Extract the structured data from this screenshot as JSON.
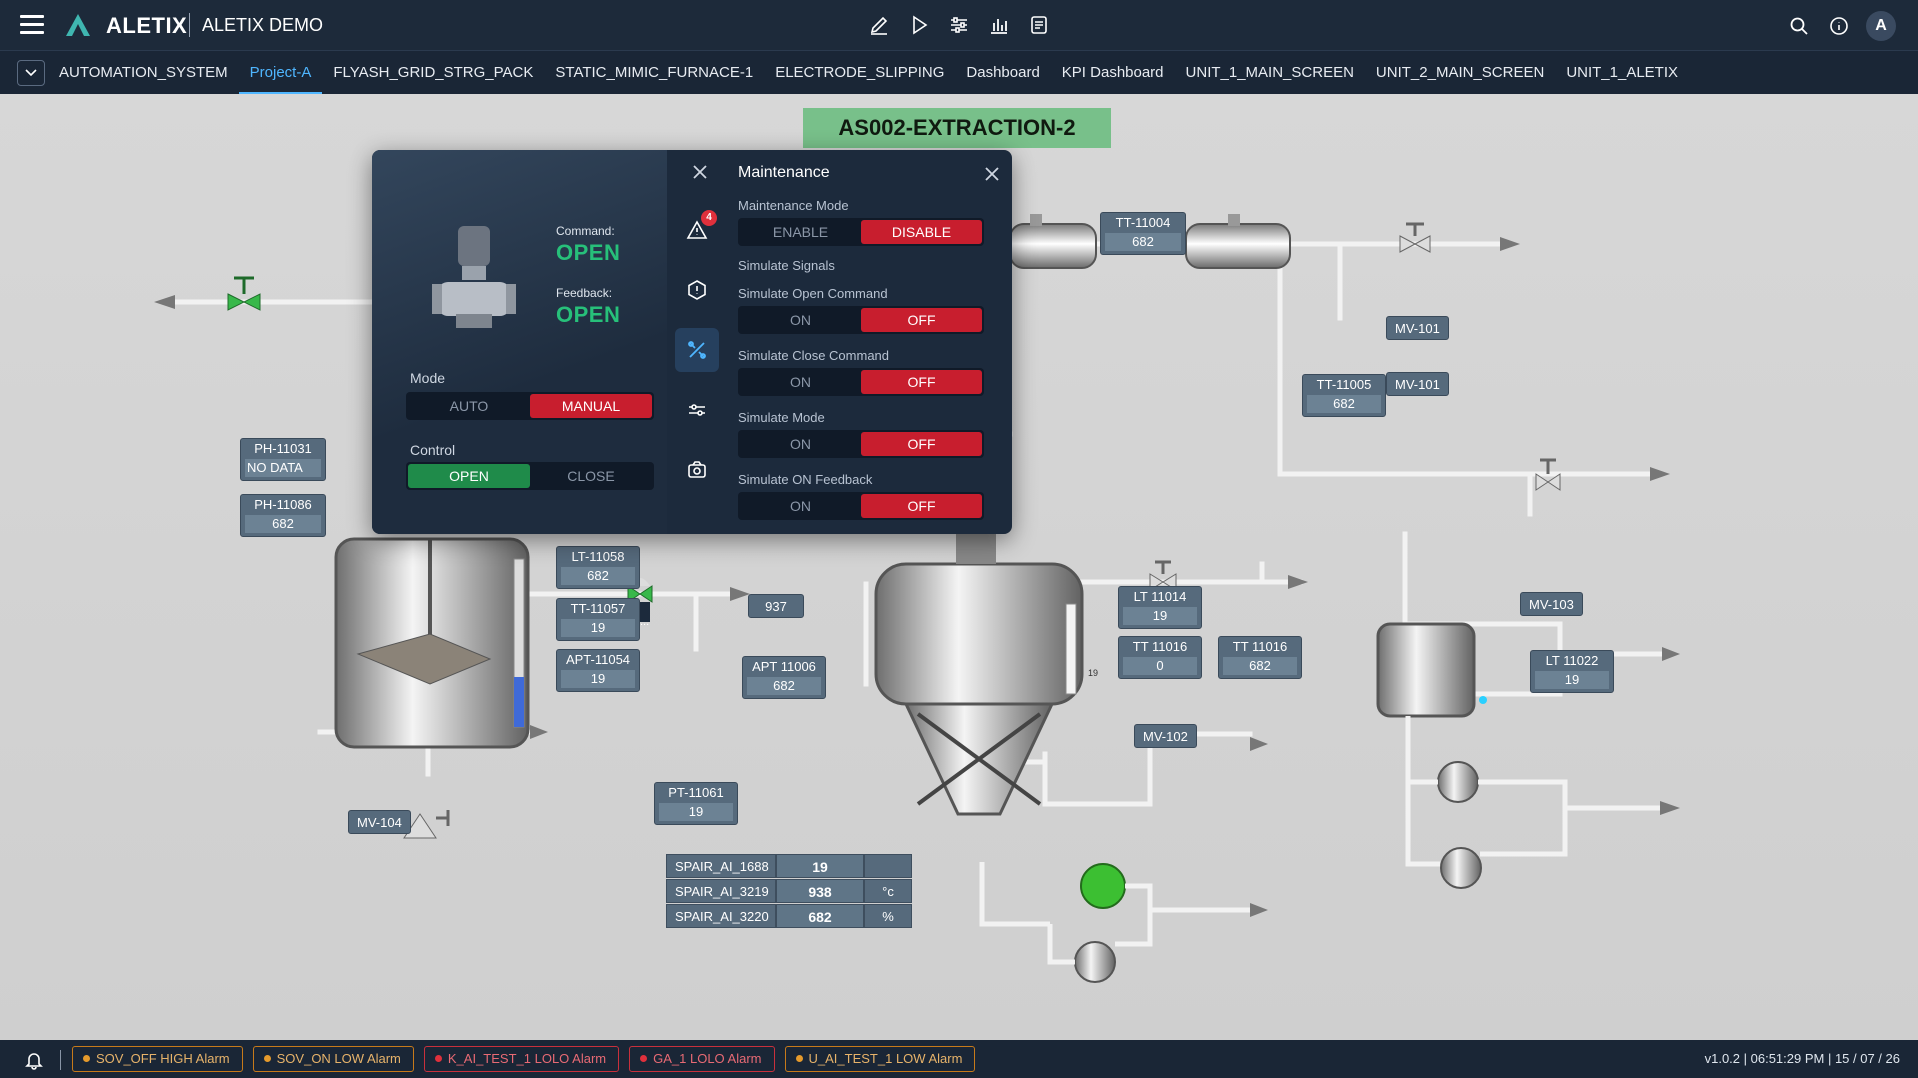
{
  "app": {
    "brand": "ALETIX",
    "project": "ALETIX DEMO",
    "user_initial": "A"
  },
  "tabs": [
    {
      "label": "AUTOMATION_SYSTEM"
    },
    {
      "label": "Project-A"
    },
    {
      "label": "FLYASH_GRID_STRG_PACK"
    },
    {
      "label": "STATIC_MIMIC_FURNACE-1"
    },
    {
      "label": "ELECTRODE_SLIPPING"
    },
    {
      "label": "Dashboard"
    },
    {
      "label": "KPI Dashboard"
    },
    {
      "label": "UNIT_1_MAIN_SCREEN"
    },
    {
      "label": "UNIT_2_MAIN_SCREEN"
    },
    {
      "label": "UNIT_1_ALETIX"
    }
  ],
  "active_tab": "Project-A",
  "canvas": {
    "title": "AS002-EXTRACTION-2",
    "tags": {
      "tt11004": {
        "name": "TT-11004",
        "value": "682"
      },
      "tt11005": {
        "name": "TT-11005",
        "value": "682"
      },
      "ph11031": {
        "name": "PH-11031",
        "value": "NO DATA"
      },
      "ph11086": {
        "name": "PH-11086",
        "value": "682"
      },
      "lt11058": {
        "name": "LT-11058",
        "value": "682"
      },
      "tt11057": {
        "name": "TT-11057",
        "value": "19"
      },
      "apt11054": {
        "name": "APT-11054",
        "value": "19"
      },
      "apt11006": {
        "name": "APT 11006",
        "value": "682"
      },
      "pt11061": {
        "name": "PT-11061",
        "value": "19"
      },
      "lt11014": {
        "name": "LT 11014",
        "value": "19"
      },
      "tt11016a": {
        "name": "TT 11016",
        "value": "0"
      },
      "tt11016b": {
        "name": "TT 11016",
        "value": "682"
      },
      "lt11022": {
        "name": "LT 11022",
        "value": "19"
      }
    },
    "labels": {
      "mv101a": "MV-101",
      "mv101b": "MV-101",
      "mv102": "MV-102",
      "mv103": "MV-103",
      "mv104": "MV-104",
      "v937": "937",
      "level_small": "19",
      "ellipsis": "..."
    },
    "spare_table": [
      {
        "name": "SPAIR_AI_1688",
        "value": "19",
        "unit": ""
      },
      {
        "name": "SPAIR_AI_3219",
        "value": "938",
        "unit": "°c"
      },
      {
        "name": "SPAIR_AI_3220",
        "value": "682",
        "unit": "%"
      }
    ]
  },
  "popup": {
    "command_label": "Command:",
    "command_value": "OPEN",
    "feedback_label": "Feedback:",
    "feedback_value": "OPEN",
    "mode_label": "Mode",
    "mode_options": [
      "AUTO",
      "MANUAL"
    ],
    "control_label": "Control",
    "control_options": [
      "OPEN",
      "CLOSE"
    ],
    "alarm_badge": "4",
    "maintenance": {
      "title": "Maintenance",
      "mode_label": "Maintenance Mode",
      "mode_options": [
        "ENABLE",
        "DISABLE"
      ],
      "simulate_signals": "Simulate Signals",
      "open_cmd_label": "Simulate Open Command",
      "close_cmd_label": "Simulate Close Command",
      "mode_sim_label": "Simulate Mode",
      "on_fb_label": "Simulate ON Feedback",
      "on": "ON",
      "off": "OFF"
    }
  },
  "alarms": [
    {
      "label": "SOV_OFF HIGH Alarm",
      "color": "#e59a2c"
    },
    {
      "label": "SOV_ON LOW Alarm",
      "color": "#e59a2c"
    },
    {
      "label": "K_AI_TEST_1 LOLO Alarm",
      "color": "#e0303c"
    },
    {
      "label": "GA_1 LOLO Alarm",
      "color": "#e0303c"
    },
    {
      "label": "U_AI_TEST_1 LOW Alarm",
      "color": "#e59a2c"
    }
  ],
  "status": "v1.0.2 | 06:51:29 PM | 15 / 07 / 26",
  "colors": {
    "accent": "#4fb6ff",
    "ok": "#27c07a",
    "danger": "#c81e2e",
    "banner": "#78c08a"
  }
}
